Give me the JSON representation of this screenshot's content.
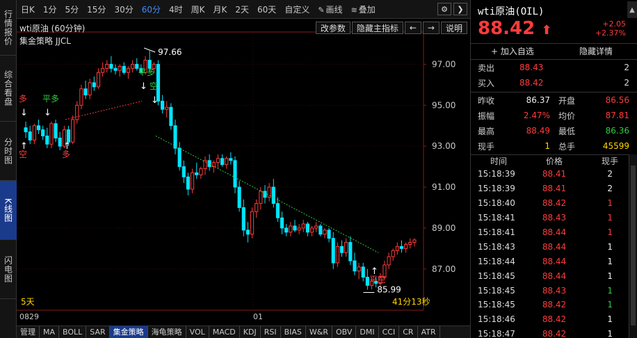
{
  "sidebar": {
    "items": [
      {
        "label": "行情报价"
      },
      {
        "label": "综合看盘"
      },
      {
        "label": "分时图"
      },
      {
        "label": "K线图"
      },
      {
        "label": "闪电图"
      }
    ]
  },
  "toolbar": {
    "periods": [
      "日K",
      "1分",
      "5分",
      "15分",
      "30分",
      "60分",
      "4时",
      "周K",
      "月K",
      "2天",
      "60天",
      "自定义"
    ],
    "active_period": "60分",
    "draw_label": "画线",
    "overlay_label": "叠加"
  },
  "chart": {
    "header": "wti原油 (60分钟)",
    "strategy": "集金策略 JJCL",
    "buttons": [
      "改参数",
      "隐藏主指标",
      "←",
      "→",
      "说明"
    ],
    "y_ticks": [
      "97.00",
      "95.00",
      "93.00",
      "91.00",
      "89.00",
      "87.00"
    ],
    "x_labels": [
      "0829",
      "01"
    ],
    "corner_left": "5天",
    "corner_right": "41分13秒",
    "high_label": "97.66",
    "low_label": "85.99",
    "signals": {
      "duo": "多",
      "ping_duo": "平多",
      "kong": "空",
      "ping_kong": "平空"
    }
  },
  "chart_data": {
    "type": "candlestick",
    "y_range": [
      85.6,
      98.0
    ],
    "ticks": [
      97,
      95,
      93,
      91,
      89,
      87
    ],
    "candles": [
      [
        93.9,
        94.2,
        93.4,
        93.7
      ],
      [
        93.7,
        94.0,
        93.1,
        93.3
      ],
      [
        93.3,
        94.1,
        93.1,
        94.0
      ],
      [
        94.0,
        94.3,
        93.6,
        93.8
      ],
      [
        93.8,
        94.0,
        93.3,
        93.5
      ],
      [
        93.5,
        93.9,
        92.9,
        93.1
      ],
      [
        93.1,
        94.2,
        92.9,
        94.1
      ],
      [
        94.1,
        94.3,
        93.2,
        93.4
      ],
      [
        93.4,
        93.7,
        92.8,
        93.0
      ],
      [
        93.0,
        94.0,
        92.9,
        93.8
      ],
      [
        93.8,
        94.0,
        93.0,
        93.2
      ],
      [
        93.2,
        94.5,
        93.1,
        94.3
      ],
      [
        94.3,
        95.2,
        94.1,
        95.0
      ],
      [
        95.0,
        96.0,
        94.8,
        95.8
      ],
      [
        95.8,
        96.2,
        95.3,
        95.5
      ],
      [
        95.5,
        96.3,
        95.3,
        96.1
      ],
      [
        96.1,
        96.4,
        95.7,
        95.9
      ],
      [
        95.9,
        96.8,
        95.8,
        96.6
      ],
      [
        96.6,
        97.1,
        96.4,
        96.8
      ],
      [
        96.8,
        97.2,
        96.6,
        97.0
      ],
      [
        97.0,
        97.4,
        96.6,
        96.8
      ],
      [
        96.8,
        97.0,
        96.5,
        96.7
      ],
      [
        96.7,
        97.0,
        96.4,
        96.9
      ],
      [
        96.9,
        97.1,
        96.5,
        96.6
      ],
      [
        96.6,
        96.9,
        96.3,
        96.8
      ],
      [
        96.8,
        97.2,
        96.6,
        97.0
      ],
      [
        97.0,
        97.3,
        96.7,
        96.8
      ],
      [
        96.8,
        97.0,
        96.5,
        96.6
      ],
      [
        96.6,
        97.4,
        96.5,
        97.2
      ],
      [
        97.2,
        97.66,
        96.6,
        96.8
      ],
      [
        96.8,
        97.1,
        96.6,
        97.0
      ],
      [
        97.0,
        97.2,
        95.0,
        95.2
      ],
      [
        95.2,
        95.5,
        94.6,
        94.8
      ],
      [
        94.8,
        95.2,
        94.4,
        94.9
      ],
      [
        94.9,
        95.1,
        93.8,
        94.0
      ],
      [
        94.0,
        94.3,
        92.6,
        92.9
      ],
      [
        92.9,
        93.2,
        91.8,
        92.0
      ],
      [
        92.0,
        92.3,
        91.2,
        91.5
      ],
      [
        91.5,
        91.7,
        90.6,
        90.9
      ],
      [
        90.9,
        91.9,
        90.7,
        91.7
      ],
      [
        91.7,
        92.2,
        91.4,
        91.6
      ],
      [
        91.6,
        92.0,
        91.4,
        91.9
      ],
      [
        91.9,
        92.5,
        91.6,
        92.3
      ],
      [
        92.3,
        92.6,
        91.8,
        92.0
      ],
      [
        92.0,
        92.3,
        91.7,
        92.2
      ],
      [
        92.2,
        92.6,
        91.9,
        92.4
      ],
      [
        92.4,
        92.6,
        92.0,
        92.1
      ],
      [
        92.1,
        92.5,
        91.9,
        92.4
      ],
      [
        92.4,
        92.7,
        92.1,
        92.3
      ],
      [
        92.3,
        92.5,
        90.7,
        91.0
      ],
      [
        91.0,
        91.3,
        89.8,
        90.0
      ],
      [
        90.0,
        90.4,
        88.6,
        88.9
      ],
      [
        88.9,
        89.3,
        88.3,
        88.7
      ],
      [
        88.7,
        90.0,
        88.5,
        89.8
      ],
      [
        89.8,
        90.4,
        89.5,
        90.2
      ],
      [
        90.2,
        91.0,
        89.9,
        90.8
      ],
      [
        90.8,
        91.1,
        90.2,
        90.5
      ],
      [
        90.5,
        91.2,
        90.3,
        91.0
      ],
      [
        91.0,
        91.4,
        90.0,
        90.2
      ],
      [
        90.2,
        90.5,
        89.3,
        89.5
      ],
      [
        89.5,
        89.8,
        88.7,
        89.0
      ],
      [
        89.0,
        89.2,
        88.6,
        88.8
      ],
      [
        88.8,
        89.3,
        88.6,
        89.1
      ],
      [
        89.1,
        89.4,
        88.8,
        88.9
      ],
      [
        88.9,
        89.2,
        88.7,
        89.0
      ],
      [
        89.0,
        89.4,
        88.8,
        89.2
      ],
      [
        89.2,
        89.3,
        88.6,
        88.8
      ],
      [
        88.8,
        89.1,
        88.6,
        89.0
      ],
      [
        89.0,
        89.3,
        88.8,
        89.1
      ],
      [
        89.1,
        89.2,
        88.6,
        88.7
      ],
      [
        88.7,
        89.0,
        88.5,
        88.9
      ],
      [
        88.9,
        89.0,
        88.3,
        88.5
      ],
      [
        88.5,
        88.8,
        87.0,
        87.3
      ],
      [
        87.3,
        88.3,
        87.1,
        88.1
      ],
      [
        88.1,
        88.4,
        87.6,
        87.8
      ],
      [
        87.8,
        88.5,
        87.6,
        88.3
      ],
      [
        88.3,
        88.6,
        87.2,
        87.4
      ],
      [
        87.4,
        87.8,
        86.7,
        86.9
      ],
      [
        86.9,
        87.3,
        86.5,
        87.1
      ],
      [
        87.1,
        87.3,
        86.4,
        86.6
      ],
      [
        86.6,
        87.0,
        85.99,
        86.2
      ],
      [
        86.2,
        86.6,
        86.0,
        86.4
      ],
      [
        86.4,
        86.6,
        86.1,
        86.3
      ],
      [
        86.3,
        86.8,
        86.1,
        86.6
      ],
      [
        86.6,
        87.4,
        86.5,
        87.2
      ],
      [
        87.2,
        87.8,
        87.0,
        87.6
      ],
      [
        87.6,
        88.0,
        87.4,
        87.9
      ],
      [
        87.9,
        88.3,
        87.7,
        88.1
      ],
      [
        88.1,
        88.4,
        87.8,
        88.0
      ],
      [
        88.0,
        88.3,
        87.8,
        88.2
      ],
      [
        88.2,
        88.5,
        88.0,
        88.3
      ],
      [
        88.3,
        88.5,
        88.1,
        88.42
      ]
    ]
  },
  "bottom_tabs": [
    "管理",
    "MA",
    "BOLL",
    "SAR",
    "集金策略",
    "海龟策略",
    "VOL",
    "MACD",
    "KDJ",
    "RSI",
    "BIAS",
    "W&R",
    "OBV",
    "DMI",
    "CCI",
    "CR",
    "ATR"
  ],
  "bottom_active": "集金策略",
  "quote": {
    "title": "wti原油(OIL)",
    "price": "88.42",
    "change": "+2.05",
    "change_pct": "+2.37%",
    "add_watch": "加入自选",
    "hide_detail": "隐藏详情"
  },
  "orderbook": {
    "sell_label": "卖出",
    "sell_price": "88.43",
    "sell_qty": "2",
    "buy_label": "买入",
    "buy_price": "88.42",
    "buy_qty": "2"
  },
  "stats": {
    "prev_close_label": "昨收",
    "prev_close": "86.37",
    "open_label": "开盘",
    "open": "86.56",
    "amp_label": "振幅",
    "amp": "2.47%",
    "avg_label": "均价",
    "avg": "87.81",
    "high_label": "最高",
    "high": "88.49",
    "low_label": "最低",
    "low": "86.36",
    "cur_label": "现手",
    "cur": "1",
    "total_label": "总手",
    "total": "45599"
  },
  "ticks_head": {
    "time": "时间",
    "price": "价格",
    "qty": "现手"
  },
  "ticks": [
    {
      "time": "15:18:39",
      "price": "88.41",
      "qty": "2",
      "color": "#eeeeee"
    },
    {
      "time": "15:18:39",
      "price": "88.41",
      "qty": "2",
      "color": "#eeeeee"
    },
    {
      "time": "15:18:40",
      "price": "88.42",
      "qty": "1",
      "color": "#ff3b3b"
    },
    {
      "time": "15:18:41",
      "price": "88.43",
      "qty": "1",
      "color": "#ff3b3b"
    },
    {
      "time": "15:18:41",
      "price": "88.44",
      "qty": "1",
      "color": "#ff3b3b"
    },
    {
      "time": "15:18:43",
      "price": "88.44",
      "qty": "1",
      "color": "#eeeeee"
    },
    {
      "time": "15:18:44",
      "price": "88.44",
      "qty": "1",
      "color": "#eeeeee"
    },
    {
      "time": "15:18:45",
      "price": "88.44",
      "qty": "1",
      "color": "#eeeeee"
    },
    {
      "time": "15:18:45",
      "price": "88.43",
      "qty": "1",
      "color": "#2ecc40"
    },
    {
      "time": "15:18:45",
      "price": "88.42",
      "qty": "1",
      "color": "#2ecc40"
    },
    {
      "time": "15:18:46",
      "price": "88.42",
      "qty": "1",
      "color": "#eeeeee"
    },
    {
      "time": "15:18:47",
      "price": "88.42",
      "qty": "1",
      "color": "#eeeeee"
    }
  ]
}
